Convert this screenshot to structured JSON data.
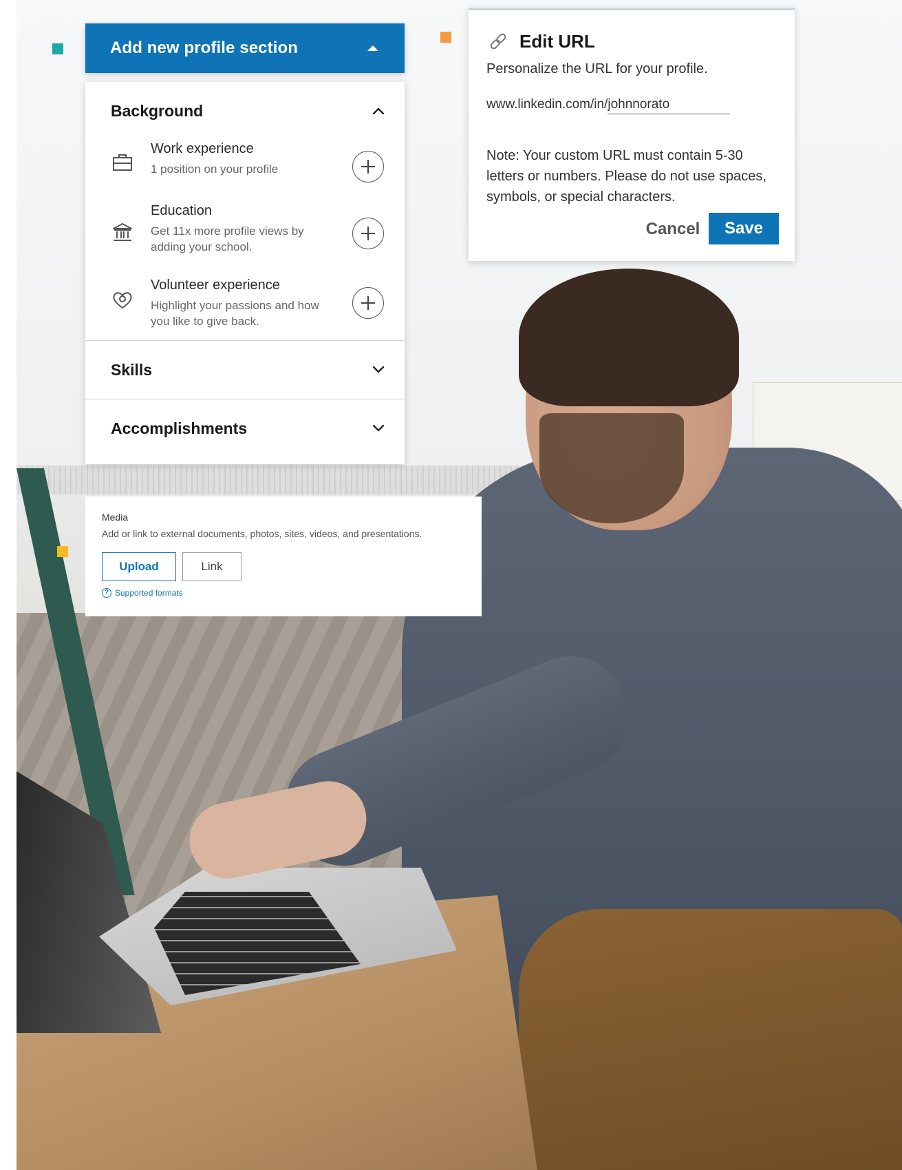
{
  "colors": {
    "accent_blue": "#0f74b6",
    "bullet_teal": "#1aa8a8",
    "bullet_orange": "#f59b3f",
    "bullet_yellow": "#f6b91c"
  },
  "add_section": {
    "header_title": "Add new profile section",
    "header_icon": "caret-up-icon",
    "background": {
      "label": "Background",
      "items": [
        {
          "icon": "briefcase-icon",
          "name": "Work experience",
          "desc": "1 position on your profile"
        },
        {
          "icon": "school-icon",
          "name": "Education",
          "desc": "Get 11x more profile views by adding your school."
        },
        {
          "icon": "volunteer-heart-icon",
          "name": "Volunteer experience",
          "desc": "Highlight your passions and how you like to give back."
        }
      ]
    },
    "skills": {
      "label": "Skills"
    },
    "accomplishments": {
      "label": "Accomplishments"
    }
  },
  "edit_url": {
    "icon": "link-icon",
    "title": "Edit URL",
    "subtitle": "Personalize the URL for your profile.",
    "url_prefix": "www.linkedin.com/in/",
    "url_value": "johnnorato",
    "note": "Note: Your custom URL must contain 5-30 letters or numbers. Please do not use spaces, symbols, or special characters.",
    "cancel_label": "Cancel",
    "save_label": "Save"
  },
  "media": {
    "title": "Media",
    "description": "Add or link to external documents, photos, sites, videos, and presentations.",
    "upload_label": "Upload",
    "link_label": "Link",
    "supported_formats_label": "Supported formats",
    "supported_formats_icon": "question-circle-icon"
  }
}
